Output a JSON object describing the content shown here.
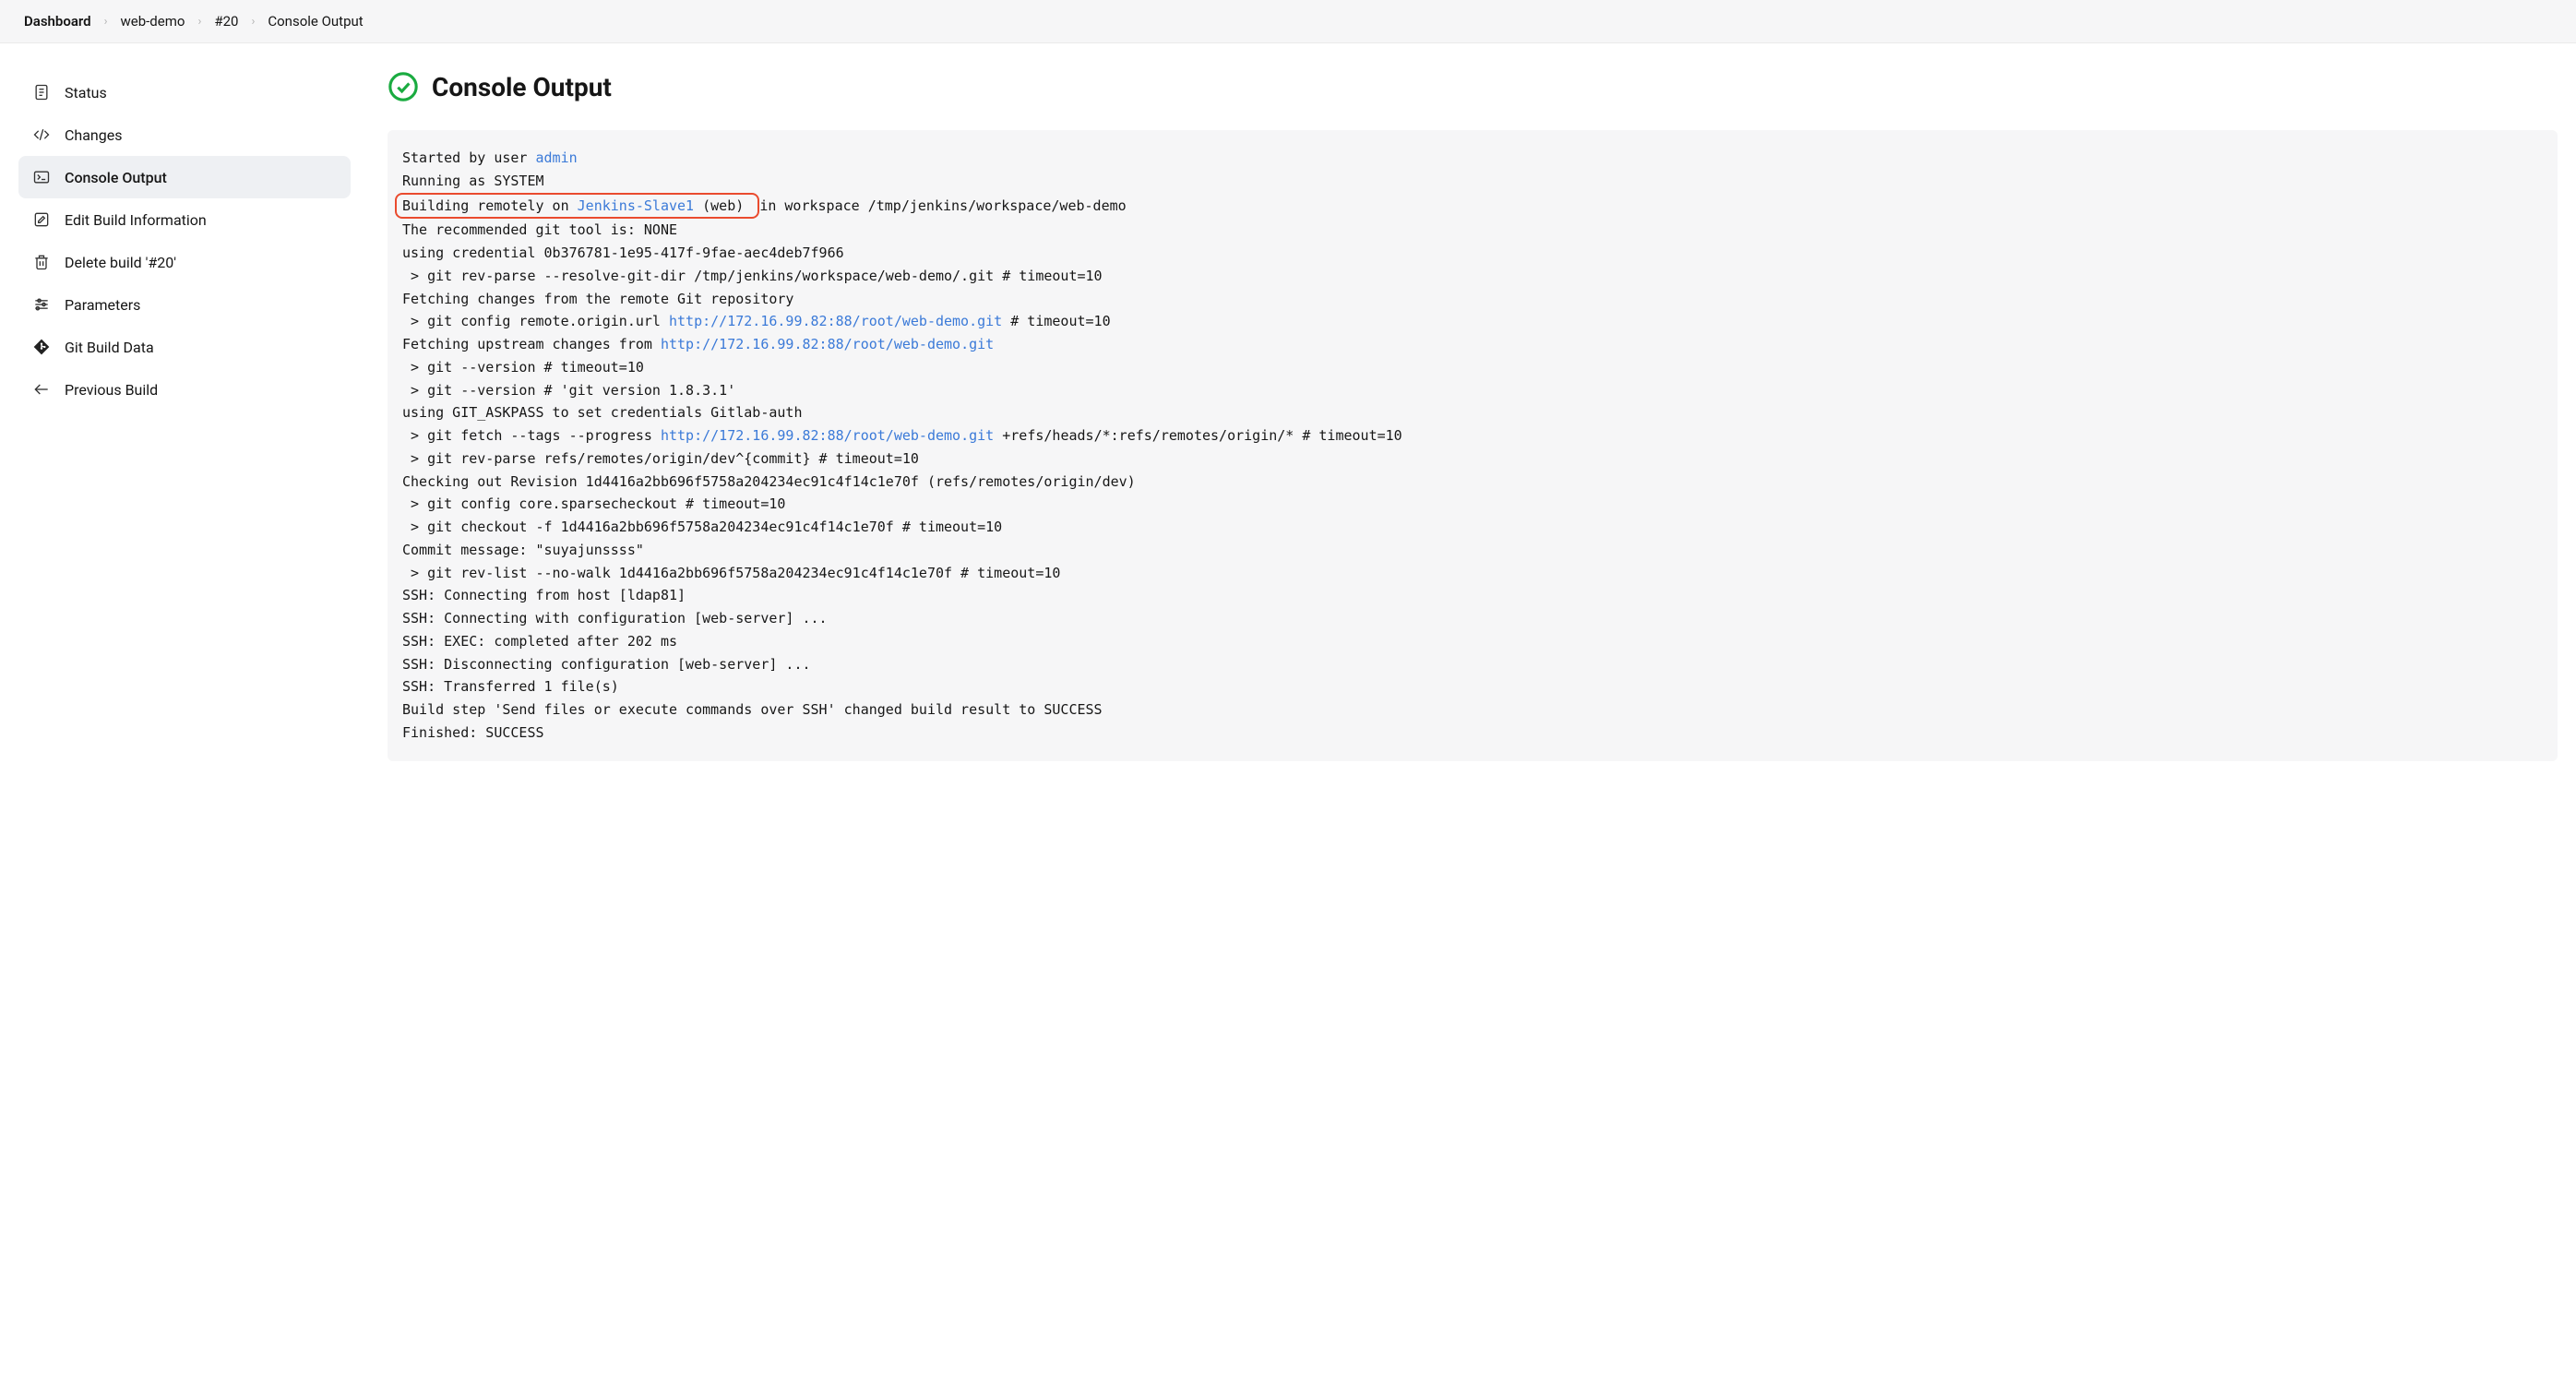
{
  "breadcrumbs": {
    "items": [
      {
        "label": "Dashboard"
      },
      {
        "label": "web-demo"
      },
      {
        "label": "#20"
      },
      {
        "label": "Console Output"
      }
    ]
  },
  "sidebar": {
    "items": [
      {
        "id": "status",
        "label": "Status",
        "icon": "document-icon",
        "active": false
      },
      {
        "id": "changes",
        "label": "Changes",
        "icon": "code-icon",
        "active": false
      },
      {
        "id": "console",
        "label": "Console Output",
        "icon": "terminal-icon",
        "active": true
      },
      {
        "id": "edit",
        "label": "Edit Build Information",
        "icon": "edit-icon",
        "active": false
      },
      {
        "id": "delete",
        "label": "Delete build '#20'",
        "icon": "trash-icon",
        "active": false
      },
      {
        "id": "params",
        "label": "Parameters",
        "icon": "sliders-icon",
        "active": false
      },
      {
        "id": "gitdata",
        "label": "Git Build Data",
        "icon": "git-icon",
        "active": false
      },
      {
        "id": "prev",
        "label": "Previous Build",
        "icon": "arrow-left-icon",
        "active": false
      }
    ]
  },
  "title": {
    "text": "Console Output",
    "status_icon": "success-check-icon"
  },
  "console": {
    "lines": [
      {
        "segs": [
          {
            "t": "Started by user "
          },
          {
            "t": "admin",
            "link": true
          }
        ]
      },
      {
        "segs": [
          {
            "t": "Running as SYSTEM"
          }
        ]
      },
      {
        "segs": [
          {
            "t": "Building remotely on ",
            "boxStart": true
          },
          {
            "t": "Jenkins-Slave1",
            "link": true
          },
          {
            "t": " (web) ",
            "boxEnd": true
          },
          {
            "t": "in workspace /tmp/jenkins/workspace/web-demo"
          }
        ]
      },
      {
        "segs": [
          {
            "t": "The recommended git tool is: NONE"
          }
        ]
      },
      {
        "segs": [
          {
            "t": "using credential 0b376781-1e95-417f-9fae-aec4deb7f966"
          }
        ]
      },
      {
        "segs": [
          {
            "t": " > git rev-parse --resolve-git-dir /tmp/jenkins/workspace/web-demo/.git # timeout=10"
          }
        ]
      },
      {
        "segs": [
          {
            "t": "Fetching changes from the remote Git repository"
          }
        ]
      },
      {
        "segs": [
          {
            "t": " > git config remote.origin.url "
          },
          {
            "t": "http://172.16.99.82:88/root/web-demo.git",
            "link": true
          },
          {
            "t": " # timeout=10"
          }
        ]
      },
      {
        "segs": [
          {
            "t": "Fetching upstream changes from "
          },
          {
            "t": "http://172.16.99.82:88/root/web-demo.git",
            "link": true
          }
        ]
      },
      {
        "segs": [
          {
            "t": " > git --version # timeout=10"
          }
        ]
      },
      {
        "segs": [
          {
            "t": " > git --version # 'git version 1.8.3.1'"
          }
        ]
      },
      {
        "segs": [
          {
            "t": "using GIT_ASKPASS to set credentials Gitlab-auth"
          }
        ]
      },
      {
        "segs": [
          {
            "t": " > git fetch --tags --progress "
          },
          {
            "t": "http://172.16.99.82:88/root/web-demo.git",
            "link": true
          },
          {
            "t": " +refs/heads/*:refs/remotes/origin/* # timeout=10"
          }
        ]
      },
      {
        "segs": [
          {
            "t": " > git rev-parse refs/remotes/origin/dev^{commit} # timeout=10"
          }
        ]
      },
      {
        "segs": [
          {
            "t": "Checking out Revision 1d4416a2bb696f5758a204234ec91c4f14c1e70f (refs/remotes/origin/dev)"
          }
        ]
      },
      {
        "segs": [
          {
            "t": " > git config core.sparsecheckout # timeout=10"
          }
        ]
      },
      {
        "segs": [
          {
            "t": " > git checkout -f 1d4416a2bb696f5758a204234ec91c4f14c1e70f # timeout=10"
          }
        ]
      },
      {
        "segs": [
          {
            "t": "Commit message: \"suyajunssss\""
          }
        ]
      },
      {
        "segs": [
          {
            "t": " > git rev-list --no-walk 1d4416a2bb696f5758a204234ec91c4f14c1e70f # timeout=10"
          }
        ]
      },
      {
        "segs": [
          {
            "t": "SSH: Connecting from host [ldap81]"
          }
        ]
      },
      {
        "segs": [
          {
            "t": "SSH: Connecting with configuration [web-server] ..."
          }
        ]
      },
      {
        "segs": [
          {
            "t": "SSH: EXEC: completed after 202 ms"
          }
        ]
      },
      {
        "segs": [
          {
            "t": "SSH: Disconnecting configuration [web-server] ..."
          }
        ]
      },
      {
        "segs": [
          {
            "t": "SSH: Transferred 1 file(s)"
          }
        ]
      },
      {
        "segs": [
          {
            "t": "Build step 'Send files or execute commands over SSH' changed build result to SUCCESS"
          }
        ]
      },
      {
        "segs": [
          {
            "t": "Finished: SUCCESS"
          }
        ]
      }
    ]
  }
}
